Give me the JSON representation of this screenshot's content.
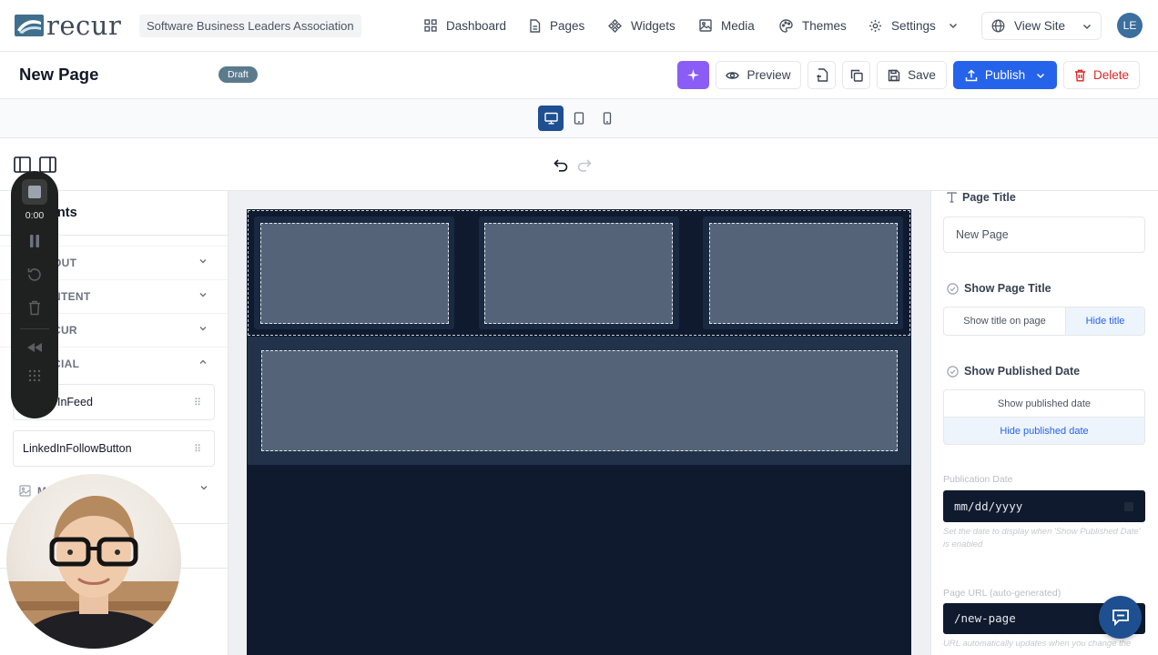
{
  "app": {
    "logo_text": "recur",
    "org_name": "Software Business Leaders Association",
    "user_initials": "LE"
  },
  "nav": {
    "items": [
      {
        "label": "Dashboard",
        "icon": "grid-icon"
      },
      {
        "label": "Pages",
        "icon": "file-icon"
      },
      {
        "label": "Widgets",
        "icon": "widgets-icon"
      },
      {
        "label": "Media",
        "icon": "image-icon"
      },
      {
        "label": "Themes",
        "icon": "palette-icon"
      },
      {
        "label": "Settings",
        "icon": "gear-icon"
      }
    ],
    "view_site": "View Site"
  },
  "page_header": {
    "title": "New Page",
    "status": "Draft",
    "preview": "Preview",
    "save": "Save",
    "publish": "Publish",
    "delete": "Delete"
  },
  "devices": {
    "active": "desktop"
  },
  "left_panel": {
    "title_partial": "nents",
    "categories": [
      {
        "label": "OUT",
        "expanded": false
      },
      {
        "label": "NTENT",
        "expanded": false
      },
      {
        "label": "CUR",
        "expanded": false
      },
      {
        "label": "CIAL",
        "expanded": true
      }
    ],
    "social_items": [
      "InFeed",
      "LinkedInFollowButton"
    ],
    "media_partial": "M"
  },
  "recorder": {
    "time": "0:00"
  },
  "right_panel": {
    "page_title_label": "Page Title",
    "page_title_value": "New Page",
    "show_page_title_label": "Show Page Title",
    "show_title_option": "Show title on page",
    "hide_title_option": "Hide title",
    "show_published_date_label": "Show Published Date",
    "show_date_option": "Show published date",
    "hide_date_option": "Hide published date",
    "publication_date_label": "Publication Date",
    "publication_date_placeholder": "mm/dd/yyyy",
    "publication_date_help": "Set the date to display when 'Show Published Date' is enabled",
    "page_url_label": "Page URL (auto-generated)",
    "page_url_value": "/new-page",
    "page_url_help": "URL automatically updates when you change the"
  },
  "colors": {
    "primary": "#2563eb",
    "ai_purple": "#8b5cf6",
    "danger": "#dc2626",
    "canvas_dark": "#0f1a2e",
    "placeholder_box": "#546377",
    "selected_option_bg": "#eef4fb",
    "selected_option_text": "#2563eb"
  }
}
